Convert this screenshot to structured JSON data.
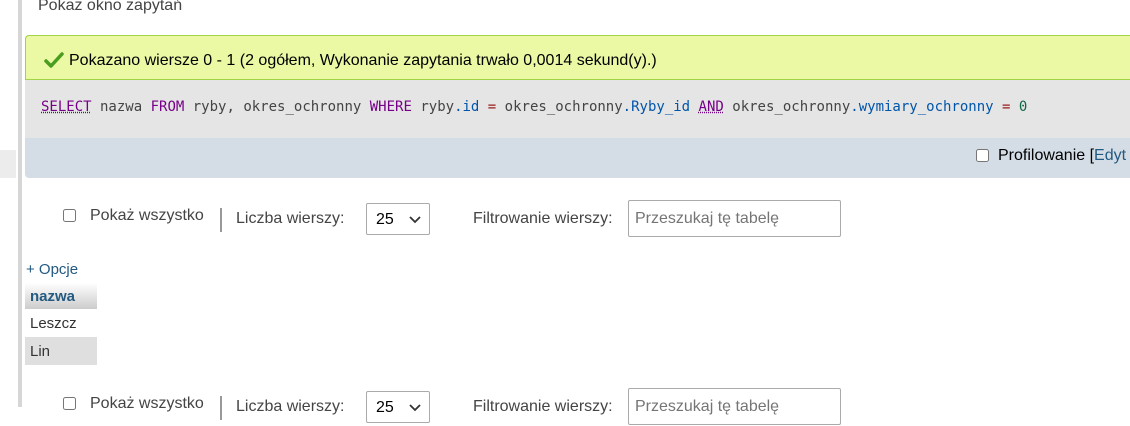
{
  "query_window": {
    "label": "Pokaż okno zapytań"
  },
  "success": {
    "icon": "check-icon",
    "message": "Pokazano wiersze 0 - 1 (2 ogółem, Wykonanie zapytania trwało 0,0014 sekund(y).)"
  },
  "sql": {
    "t1": "SELECT",
    "t2": " nazwa ",
    "t3": "FROM",
    "t4": " ryby, okres_ochronny ",
    "t5": "WHERE",
    "t6": " ryby",
    "t7": ".id",
    "t8": " = ",
    "t9": "okres_ochronny",
    "t10": ".Ryby_id",
    "t11": " ",
    "t12": "AND",
    "t13": " okres_ochronny",
    "t14": ".wymiary_ochronny",
    "t15": " = ",
    "t16": "0"
  },
  "profiling": {
    "label": "Profilowanie [",
    "edit_label": "Edyt"
  },
  "nav": {
    "show_all_label": "Pokaż wszystko",
    "rows_label": "Liczba wierszy:",
    "rows_value": "25",
    "filter_label": "Filtrowanie wierszy:",
    "search_placeholder": "Przeszukaj tę tabelę"
  },
  "options_label": "+ Opcje",
  "results": {
    "columns": [
      "nazwa"
    ],
    "rows": [
      [
        "Leszcz"
      ],
      [
        "Lin"
      ]
    ]
  },
  "colors": {
    "success_bg": "#ebf8a4",
    "sql_bg": "#e5e5e5",
    "profiling_bg": "#d4dde5",
    "link": "#235a81"
  }
}
